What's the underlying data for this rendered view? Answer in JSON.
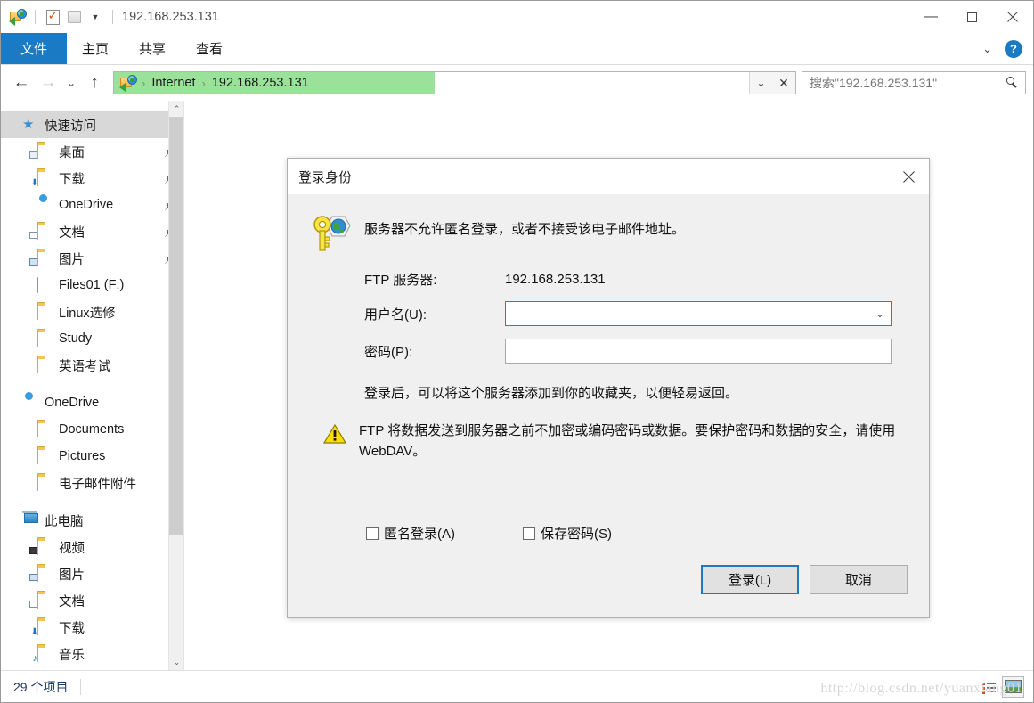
{
  "window": {
    "title_path": "192.168.253.131",
    "quick_access_icons": [
      "ftp-folder-icon",
      "properties-icon",
      "new-folder-icon",
      "customize-dropdown-icon"
    ],
    "controls": {
      "minimize": "—",
      "maximize": "☐",
      "close": "✕"
    }
  },
  "ribbon": {
    "tabs": [
      {
        "label": "文件",
        "active": true
      },
      {
        "label": "主页",
        "active": false
      },
      {
        "label": "共享",
        "active": false
      },
      {
        "label": "查看",
        "active": false
      }
    ],
    "expand_chevron": "⌄",
    "help_label": "?"
  },
  "nav": {
    "back": "←",
    "forward": "→",
    "recent": "⌄",
    "up": "↑",
    "address": {
      "icon": "ftp-folder-icon",
      "crumbs": [
        "Internet",
        "192.168.253.131"
      ],
      "separator": "›",
      "dropdown": "⌄",
      "stop": "✕",
      "progress_percent": 47
    },
    "search": {
      "placeholder": "搜索\"192.168.253.131\"",
      "value": "",
      "icon": "search-icon"
    }
  },
  "sidebar": {
    "items": [
      {
        "label": "快速访问",
        "icon": "star-icon",
        "level": 0,
        "selected": true,
        "pinned": false
      },
      {
        "label": "桌面",
        "icon": "folder-desktop-icon",
        "level": 1,
        "selected": false,
        "pinned": true
      },
      {
        "label": "下载",
        "icon": "folder-download-icon",
        "level": 1,
        "selected": false,
        "pinned": true
      },
      {
        "label": "OneDrive",
        "icon": "cloud-icon",
        "level": 1,
        "selected": false,
        "pinned": true
      },
      {
        "label": "文档",
        "icon": "folder-documents-icon",
        "level": 1,
        "selected": false,
        "pinned": true
      },
      {
        "label": "图片",
        "icon": "folder-pictures-icon",
        "level": 1,
        "selected": false,
        "pinned": true
      },
      {
        "label": "Files01 (F:)",
        "icon": "drive-icon",
        "level": 1,
        "selected": false,
        "pinned": false
      },
      {
        "label": "Linux选修",
        "icon": "folder-icon",
        "level": 1,
        "selected": false,
        "pinned": false
      },
      {
        "label": "Study",
        "icon": "folder-icon",
        "level": 1,
        "selected": false,
        "pinned": false
      },
      {
        "label": "英语考试",
        "icon": "folder-icon",
        "level": 1,
        "selected": false,
        "pinned": false
      },
      {
        "label": "OneDrive",
        "icon": "cloud-icon",
        "level": 0,
        "selected": false,
        "pinned": false,
        "gap_before": true
      },
      {
        "label": "Documents",
        "icon": "folder-icon",
        "level": 1,
        "selected": false,
        "pinned": false
      },
      {
        "label": "Pictures",
        "icon": "folder-icon",
        "level": 1,
        "selected": false,
        "pinned": false
      },
      {
        "label": "电子邮件附件",
        "icon": "folder-icon",
        "level": 1,
        "selected": false,
        "pinned": false
      },
      {
        "label": "此电脑",
        "icon": "computer-icon",
        "level": 0,
        "selected": false,
        "pinned": false,
        "gap_before": true
      },
      {
        "label": "视频",
        "icon": "folder-videos-icon",
        "level": 1,
        "selected": false,
        "pinned": false
      },
      {
        "label": "图片",
        "icon": "folder-pictures-icon",
        "level": 1,
        "selected": false,
        "pinned": false
      },
      {
        "label": "文档",
        "icon": "folder-documents-icon",
        "level": 1,
        "selected": false,
        "pinned": false
      },
      {
        "label": "下载",
        "icon": "folder-download-icon",
        "level": 1,
        "selected": false,
        "pinned": false
      },
      {
        "label": "音乐",
        "icon": "folder-music-icon",
        "level": 1,
        "selected": false,
        "pinned": false
      }
    ],
    "scroll_up": "⌃",
    "scroll_down": "⌄"
  },
  "dialog": {
    "title": "登录身份",
    "close_label": "✕",
    "message": "服务器不允许匿名登录，或者不接受该电子邮件地址。",
    "server_label": "FTP 服务器:",
    "server_value": "192.168.253.131",
    "username_label": "用户名(U):",
    "username_value": "",
    "password_label": "密码(P):",
    "password_value": "",
    "hint": "登录后，可以将这个服务器添加到你的收藏夹，以便轻易返回。",
    "warning": "FTP 将数据发送到服务器之前不加密或编码密码或数据。要保护密码和数据的安全，请使用 WebDAV。",
    "checkbox_anonymous": "匿名登录(A)",
    "checkbox_save_password": "保存密码(S)",
    "button_login": "登录(L)",
    "button_cancel": "取消"
  },
  "statusbar": {
    "item_count": "29 个项目",
    "view_details": "details-view-icon",
    "view_large_icons": "large-icons-view-icon"
  },
  "watermark": "http://blog.csdn.net/yuanxiang01",
  "colors": {
    "accent_blue": "#1a7bc4",
    "address_progress_green": "#9ae29a",
    "selected_gray": "#d8d8d8",
    "dialog_bg": "#f0f0f0",
    "status_text": "#1f3864"
  }
}
